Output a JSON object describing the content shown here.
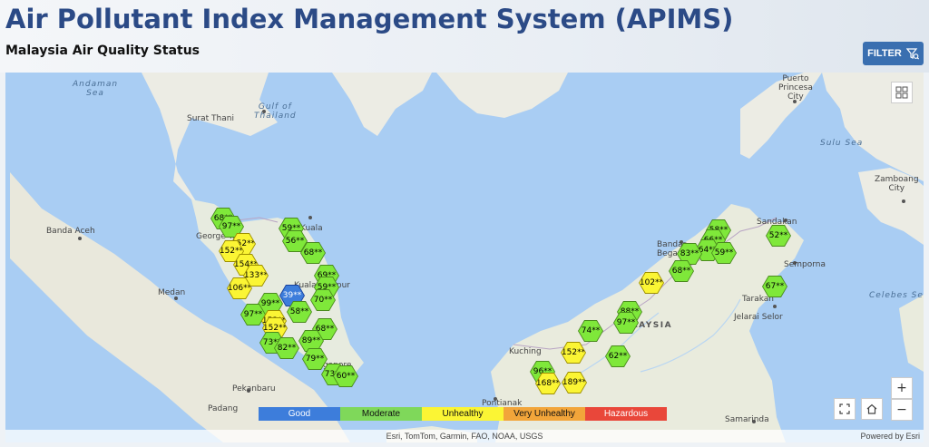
{
  "header": {
    "title": "Air Pollutant Index Management System (APIMS)",
    "subtitle": "Malaysia Air Quality Status",
    "filter_label": "FILTER"
  },
  "map": {
    "labels": {
      "andaman_sea": "Andaman\nSea",
      "gulf_of_thailand": "Gulf of\nThailand",
      "surat_thani": "Surat Thani",
      "puerto_princesa": "Puerto\nPrincesa\nCity",
      "sulu_sea": "Sulu Sea",
      "zamboanga": "Zamboang\nCity",
      "banda_aceh": "Banda Aceh",
      "georgetown": "George Town",
      "kuala": "Kuala",
      "kuala_lumpur": "Kuala Lumpur",
      "medan": "Medan",
      "sandakan": "Sandakan",
      "bandar_begawan": "Bandar\nBegawan",
      "semporna": "Semporna",
      "tarakan": "Tarakan",
      "celebes_sea": "Celebes Se",
      "malaysia": "MALAYSIA",
      "jelarai_selor": "Jelarai Selor",
      "kuching": "Kuching",
      "singapore": "Singapore",
      "pekanbaru": "Pekanbaru",
      "pontianak": "Pontianak",
      "samarinda": "Samarinda",
      "padang": "Padang"
    },
    "stations": [
      {
        "label": "68**",
        "level": "moderate"
      },
      {
        "label": "97**",
        "level": "moderate"
      },
      {
        "label": "152**",
        "level": "unhealthy"
      },
      {
        "label": "152**",
        "level": "unhealthy"
      },
      {
        "label": "154**",
        "level": "unhealthy"
      },
      {
        "label": "133**",
        "level": "unhealthy"
      },
      {
        "label": "106**",
        "level": "unhealthy"
      },
      {
        "label": "99**",
        "level": "moderate"
      },
      {
        "label": "97**",
        "level": "moderate"
      },
      {
        "label": "153**",
        "level": "unhealthy"
      },
      {
        "label": "152**",
        "level": "unhealthy"
      },
      {
        "label": "73**",
        "level": "moderate"
      },
      {
        "label": "82**",
        "level": "moderate"
      },
      {
        "label": "59**",
        "level": "moderate"
      },
      {
        "label": "56**",
        "level": "moderate"
      },
      {
        "label": "68**",
        "level": "moderate"
      },
      {
        "label": "69**",
        "level": "moderate"
      },
      {
        "label": "59**",
        "level": "moderate"
      },
      {
        "label": "70**",
        "level": "moderate"
      },
      {
        "label": "39**",
        "level": "good"
      },
      {
        "label": "58**",
        "level": "moderate"
      },
      {
        "label": "68**",
        "level": "moderate"
      },
      {
        "label": "89**",
        "level": "moderate"
      },
      {
        "label": "79**",
        "level": "moderate"
      },
      {
        "label": "73**",
        "level": "moderate"
      },
      {
        "label": "60**",
        "level": "moderate"
      },
      {
        "label": "58**",
        "level": "moderate"
      },
      {
        "label": "66**",
        "level": "moderate"
      },
      {
        "label": "64**",
        "level": "moderate"
      },
      {
        "label": "83**",
        "level": "moderate"
      },
      {
        "label": "59**",
        "level": "moderate"
      },
      {
        "label": "68**",
        "level": "moderate"
      },
      {
        "label": "52**",
        "level": "moderate"
      },
      {
        "label": "102**",
        "level": "unhealthy"
      },
      {
        "label": "67**",
        "level": "moderate"
      },
      {
        "label": "88**",
        "level": "moderate"
      },
      {
        "label": "97**",
        "level": "moderate"
      },
      {
        "label": "74**",
        "level": "moderate"
      },
      {
        "label": "152**",
        "level": "unhealthy"
      },
      {
        "label": "62**",
        "level": "moderate"
      },
      {
        "label": "96**",
        "level": "moderate"
      },
      {
        "label": "168**",
        "level": "unhealthy"
      },
      {
        "label": "189**",
        "level": "unhealthy"
      }
    ],
    "legend": [
      {
        "label": "Good",
        "color": "#3d7ddb",
        "text_color": "#ffffff"
      },
      {
        "label": "Moderate",
        "color": "#7fd85a",
        "text_color": "#111111"
      },
      {
        "label": "Unhealthy",
        "color": "#fbf534",
        "text_color": "#111111"
      },
      {
        "label": "Very Unhealthy",
        "color": "#f2a53a",
        "text_color": "#111111"
      },
      {
        "label": "Hazardous",
        "color": "#e9473a",
        "text_color": "#ffffff"
      }
    ],
    "level_colors": {
      "good": "#3d7ddb",
      "moderate": "#7fe83a",
      "unhealthy": "#fbf534"
    },
    "controls": {
      "zoom_in": "+",
      "zoom_out": "−"
    },
    "attribution": "Esri, TomTom, Garmin, FAO, NOAA, USGS",
    "powered_by": "Powered by Esri"
  }
}
